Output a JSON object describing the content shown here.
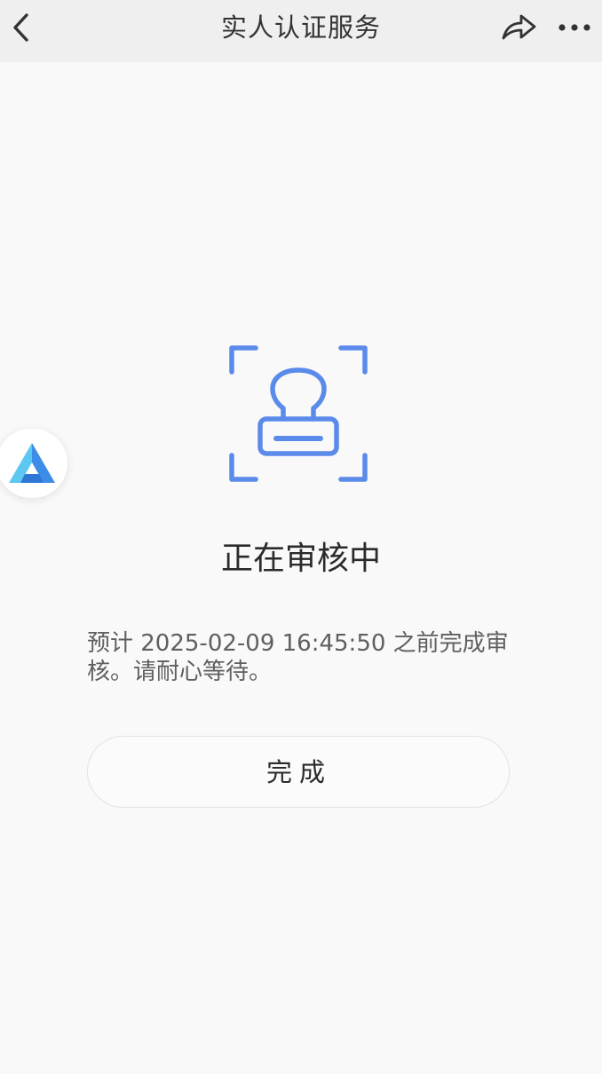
{
  "nav": {
    "title": "实人认证服务",
    "icons": [
      "back-chevron-icon",
      "share-icon",
      "more-dots-icon"
    ]
  },
  "floating_app": {
    "icon": "app-logo-triangle-icon",
    "colors": [
      "#3b8de8",
      "#5cc8f2"
    ]
  },
  "status": {
    "icon": "stamp-in-frame-icon",
    "accent_color": "#5b8bea",
    "title": "正在审核中",
    "description": "预计 2025-02-09 16:45:50 之前完成审核。请耐心等待。"
  },
  "actions": {
    "done_label": "完成"
  }
}
